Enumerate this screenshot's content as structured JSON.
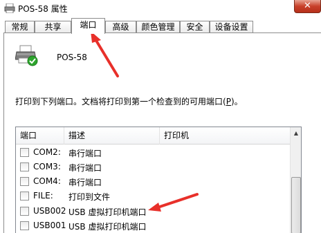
{
  "window": {
    "title": "POS-58 属性",
    "close_label": "✕"
  },
  "tabs": [
    "常规",
    "共享",
    "端口",
    "高级",
    "颜色管理",
    "安全",
    "设备设置"
  ],
  "active_tab": "端口",
  "printer": {
    "name": "POS-58"
  },
  "description": "打印到下列端口。文档将打印到第一个检查到的可用端口(",
  "description_key": "P",
  "description_end": ")。",
  "port_list": {
    "columns": [
      "端口",
      "描述",
      "打印机"
    ],
    "rows": [
      {
        "port": "COM2:",
        "desc": "串行端口",
        "printer": "",
        "checked": false
      },
      {
        "port": "COM3:",
        "desc": "串行端口",
        "printer": "",
        "checked": false
      },
      {
        "port": "COM4:",
        "desc": "串行端口",
        "printer": "",
        "checked": false
      },
      {
        "port": "FILE:",
        "desc": "打印到文件",
        "printer": "",
        "checked": false
      },
      {
        "port": "USB002",
        "desc": "USB 虚拟打印机端口",
        "printer": "",
        "checked": false
      },
      {
        "port": "USB001",
        "desc": "USB 虚拟打印机端口",
        "printer": "",
        "checked": false
      }
    ]
  },
  "colors": {
    "annotation_arrow": "#e8302a",
    "check_badge": "#2da52d"
  }
}
